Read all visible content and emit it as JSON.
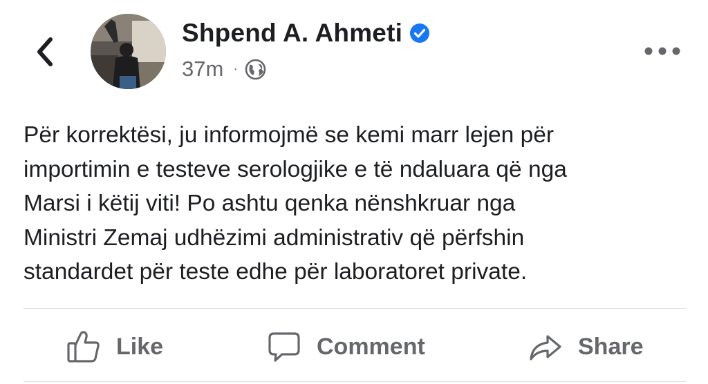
{
  "header": {
    "back_icon": "chevron-left-icon",
    "author_name": "Shpend A. Ahmeti",
    "verified_icon": "verified-badge-icon",
    "time": "37m",
    "separator": "·",
    "privacy_icon": "globe-icon",
    "more_icon": "more-horizontal-icon"
  },
  "post": {
    "text": "Për korrektësi, ju informojmë se kemi marr lejen për\nimportimin e testeve serologjike e të ndaluara që nga\nMarsi i këtij viti!  Po ashtu qenka nënshkruar nga\nMinistri Zemaj udhëzimi administrativ që përfshin\nstandardet për teste edhe për laboratoret private."
  },
  "actions": {
    "like_label": "Like",
    "comment_label": "Comment",
    "share_label": "Share"
  },
  "colors": {
    "text": "#1c1e21",
    "secondary": "#65676b",
    "verified": "#1877f2",
    "divider": "#dadde1"
  }
}
